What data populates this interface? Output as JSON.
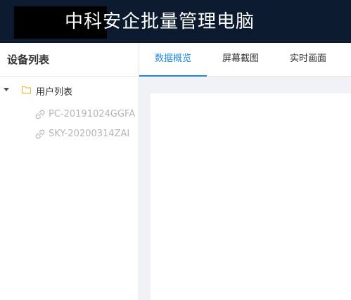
{
  "header": {
    "title": "中科安企批量管理电脑",
    "background_color": "#0c1a2f",
    "logo_block_color": "#000000"
  },
  "sidebar": {
    "title": "设备列表",
    "tree": {
      "root": {
        "label": "用户列表",
        "icon": "folder-icon",
        "expanded": true
      },
      "items": [
        {
          "label": "PC-20191024GGFA",
          "icon": "link-broken-icon"
        },
        {
          "label": "SKY-20200314ZAI",
          "icon": "link-broken-icon"
        }
      ]
    }
  },
  "tabs": [
    {
      "label": "数据概览",
      "active": true
    },
    {
      "label": "屏幕截图",
      "active": false
    },
    {
      "label": "实时画面",
      "active": false
    }
  ],
  "colors": {
    "accent": "#1e88e5",
    "folder": "#e6b422",
    "muted_text": "#b5b5b5",
    "content_bg": "#f0f2f5"
  }
}
